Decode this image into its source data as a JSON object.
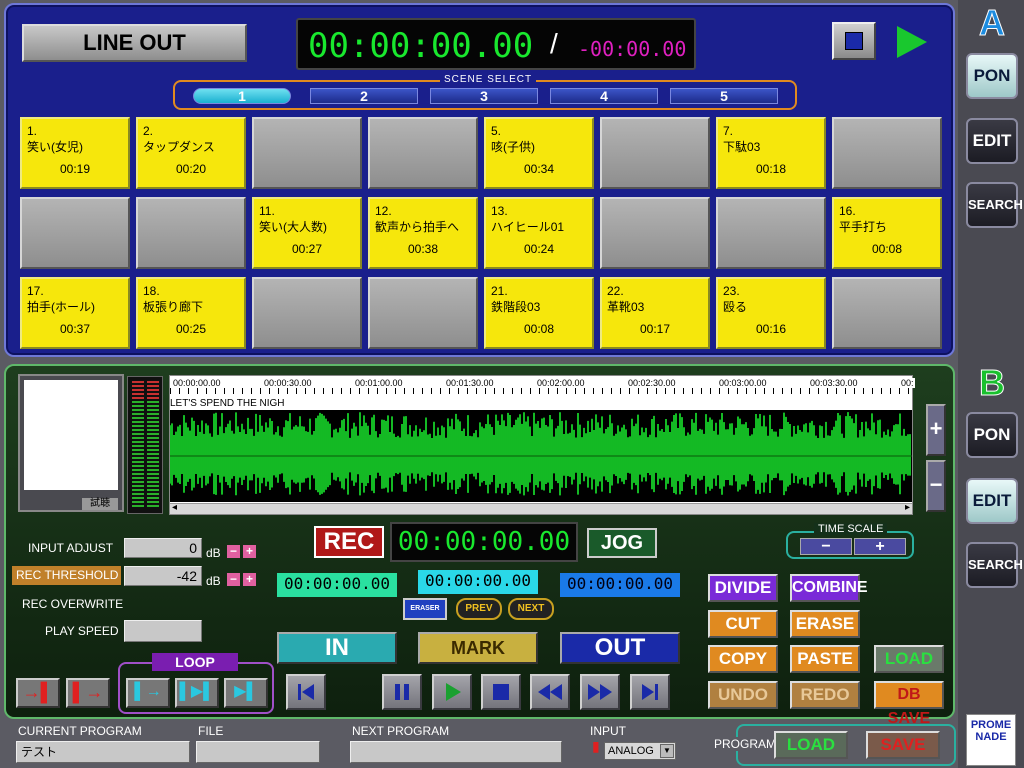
{
  "panelA": {
    "letter": "A",
    "line_out": "LINE OUT",
    "time_main": "00:00:00.00",
    "time_sep": "/",
    "time_remain": "-00:00.00",
    "scene_select_label": "SCENE SELECT",
    "scenes": [
      "1",
      "2",
      "3",
      "4",
      "5"
    ],
    "selected_scene": "1",
    "pads": [
      {
        "num": "1.",
        "name": "笑い(女児)",
        "time": "00:19"
      },
      {
        "num": "2.",
        "name": "タップダンス",
        "time": "00:20"
      },
      null,
      null,
      {
        "num": "5.",
        "name": "咳(子供)",
        "time": "00:34"
      },
      null,
      {
        "num": "7.",
        "name": "下駄03",
        "time": "00:18"
      },
      null,
      null,
      null,
      {
        "num": "11.",
        "name": "笑い(大人数)",
        "time": "00:27"
      },
      {
        "num": "12.",
        "name": "歓声から拍手へ",
        "time": "00:38"
      },
      {
        "num": "13.",
        "name": "ハイヒール01",
        "time": "00:24"
      },
      null,
      null,
      {
        "num": "16.",
        "name": "平手打ち",
        "time": "00:08"
      },
      {
        "num": "17.",
        "name": "拍手(ホール)",
        "time": "00:37"
      },
      {
        "num": "18.",
        "name": "板張り廊下",
        "time": "00:25"
      },
      null,
      null,
      {
        "num": "21.",
        "name": "鉄階段03",
        "time": "00:08"
      },
      {
        "num": "22.",
        "name": "革靴03",
        "time": "00:17"
      },
      {
        "num": "23.",
        "name": "殴る",
        "time": "00:16"
      },
      null
    ]
  },
  "sidebar": {
    "pon": "PON",
    "edit": "EDIT",
    "search": "SEARCH"
  },
  "panelB": {
    "letter": "B",
    "preview_btn": "試聴",
    "ruler": [
      "00:00:00.00",
      "00:00:30.00",
      "00:01:00.00",
      "00:01:30.00",
      "00:02:00.00",
      "00:02:30.00",
      "00:03:00.00",
      "00:03:30.00",
      "00:"
    ],
    "track_title": "LET'S SPEND THE NIGH",
    "zoom_plus": "+",
    "zoom_minus": "−",
    "input_adjust_label": "INPUT ADJUST",
    "input_adjust_value": "0",
    "rec_threshold_label": "REC THRESHOLD",
    "rec_threshold_value": "-42",
    "db": "dB",
    "rec_overwrite_label": "REC OVERWRITE",
    "play_speed_label": "PLAY SPEED",
    "loop_label": "LOOP",
    "rec": "REC",
    "rec_time": "00:00:00.00",
    "jog": "JOG",
    "time_scale_label": "TIME SCALE",
    "tc_in": "00:00:00.00",
    "tc_mark": "00:00:00.00",
    "tc_out": "00:00:00.00",
    "eraser": "ERASER",
    "prev": "PREV",
    "next": "NEXT",
    "in": "IN",
    "mark": "MARK",
    "out": "OUT",
    "divide": "DIVIDE",
    "combine": "COMBINE",
    "cut": "CUT",
    "erase": "ERASE",
    "copy": "COPY",
    "paste": "PASTE",
    "undo": "UNDO",
    "redo": "REDO",
    "load": "LOAD",
    "dbsave": "DB SAVE"
  },
  "footer": {
    "current_program_label": "CURRENT PROGRAM",
    "current_program_value": "テスト",
    "file_label": "FILE",
    "file_value": "",
    "next_program_label": "NEXT PROGRAM",
    "next_program_value": "",
    "input_label": "INPUT",
    "input_value": "ANALOG",
    "program_label": "PROGRAM",
    "load": "LOAD",
    "save": "SAVE",
    "logo": "PROMENADE"
  },
  "colors": {
    "panelA": "#1a1f8c",
    "pad_yellow": "#f6e70c",
    "waveform": "#19e82e",
    "accent_orange": "#e08a20"
  }
}
